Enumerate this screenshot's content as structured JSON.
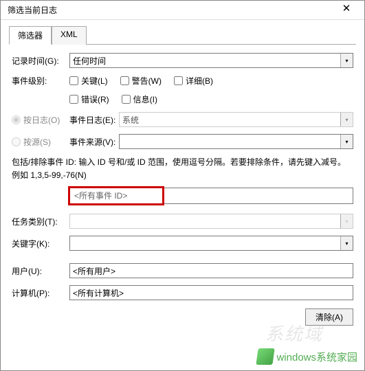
{
  "window": {
    "title": "筛选当前日志"
  },
  "tabs": {
    "filter": "筛选器",
    "xml": "XML"
  },
  "labels": {
    "logged": "记录时间(G):",
    "level": "事件级别:",
    "byLog": "按日志(O)",
    "bySource": "按源(S)",
    "eventLog": "事件日志(E):",
    "eventSource": "事件来源(V):",
    "taskCategory": "任务类别(T):",
    "keywords": "关键字(K):",
    "user": "用户(U):",
    "computer": "计算机(P):"
  },
  "values": {
    "logged": "任何时间",
    "eventLog": "系统",
    "eventSource": "",
    "eventId": "<所有事件 ID>",
    "taskCategory": "",
    "keywords": "",
    "user": "<所有用户>",
    "computer": "<所有计算机>"
  },
  "checkboxes": {
    "critical": "关键(L)",
    "warning": "警告(W)",
    "verbose": "详细(B)",
    "error": "错误(R)",
    "info": "信息(I)"
  },
  "helpText": "包括/排除事件 ID: 输入 ID 号和/或 ID 范围，使用逗号分隔。若要排除条件，请先键入减号。例如 1,3,5-99,-76(N)",
  "buttons": {
    "clear": "清除(A)"
  },
  "watermark": {
    "brand": "windows系统家园"
  }
}
